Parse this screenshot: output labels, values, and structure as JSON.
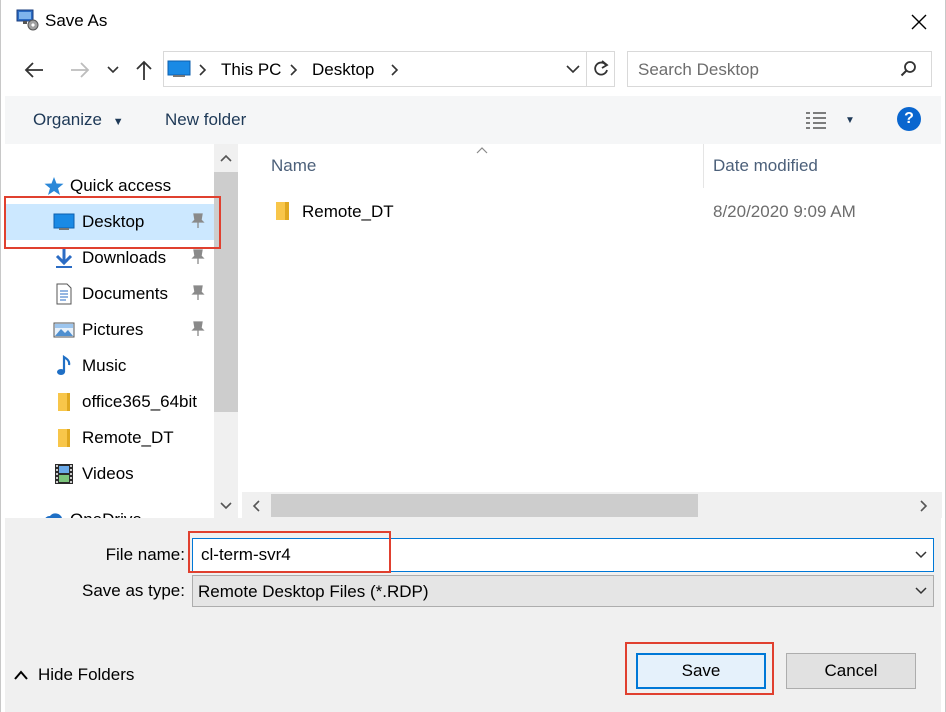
{
  "window": {
    "title": "Save As"
  },
  "address": {
    "segments": [
      "This PC",
      "Desktop"
    ]
  },
  "search": {
    "placeholder": "Search Desktop"
  },
  "toolbar": {
    "organize_label": "Organize",
    "new_folder_label": "New folder"
  },
  "sidebar": {
    "items": [
      {
        "label": "Quick access",
        "icon": "star-icon",
        "pinned": false
      },
      {
        "label": "Desktop",
        "icon": "desktop-icon",
        "pinned": true,
        "selected": true
      },
      {
        "label": "Downloads",
        "icon": "download-arrow-icon",
        "pinned": true
      },
      {
        "label": "Documents",
        "icon": "document-icon",
        "pinned": true
      },
      {
        "label": "Pictures",
        "icon": "picture-icon",
        "pinned": true
      },
      {
        "label": "Music",
        "icon": "music-note-icon",
        "pinned": false
      },
      {
        "label": "office365_64bit",
        "icon": "folder-icon",
        "pinned": false
      },
      {
        "label": "Remote_DT",
        "icon": "folder-icon",
        "pinned": false
      },
      {
        "label": "Videos",
        "icon": "film-icon",
        "pinned": false
      },
      {
        "label": "OneDrive",
        "icon": "cloud-icon",
        "pinned": false
      }
    ]
  },
  "file_list": {
    "columns": [
      "Name",
      "Date modified"
    ],
    "rows": [
      {
        "name": "Remote_DT",
        "date_modified": "8/20/2020 9:09 AM",
        "icon": "folder-icon"
      }
    ]
  },
  "form": {
    "file_name_label": "File name:",
    "file_name_value": "cl-term-svr4",
    "save_type_label": "Save as type:",
    "save_type_value": "Remote Desktop Files (*.RDP)"
  },
  "footer": {
    "hide_folders_label": "Hide Folders",
    "save_label": "Save",
    "cancel_label": "Cancel"
  },
  "colors": {
    "accent": "#0078d7",
    "highlight": "#e0402f",
    "folder": "#f8c64a",
    "selected": "#cce8ff"
  }
}
